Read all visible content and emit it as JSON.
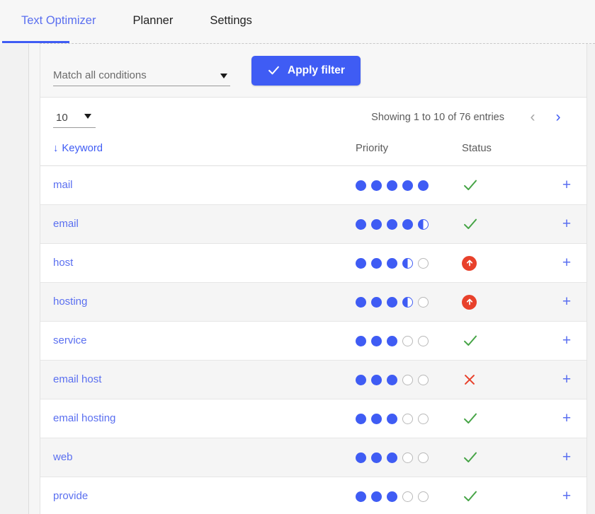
{
  "tabs": [
    {
      "label": "Text Optimizer",
      "active": true
    },
    {
      "label": "Planner",
      "active": false
    },
    {
      "label": "Settings",
      "active": false
    }
  ],
  "filter": {
    "condition_value": "Match all conditions",
    "condition_placeholder": "Match all conditions",
    "apply_label": "Apply filter",
    "check_icon": "check-icon",
    "caret_icon": "chevron-down-icon"
  },
  "pagination": {
    "page_length": "10",
    "entries_text": "Showing 1 to 10 of 76 entries",
    "prev_icon": "‹",
    "next_icon": "›",
    "prev_enabled": false,
    "next_enabled": true
  },
  "table": {
    "columns": {
      "keyword": "Keyword",
      "priority": "Priority",
      "status": "Status",
      "action": ""
    },
    "sort_arrow": "↓",
    "add_label": "+",
    "rows": [
      {
        "keyword": "mail",
        "priority": [
          "full",
          "full",
          "full",
          "full",
          "full"
        ],
        "status": "check"
      },
      {
        "keyword": "email",
        "priority": [
          "full",
          "full",
          "full",
          "full",
          "half"
        ],
        "status": "check"
      },
      {
        "keyword": "host",
        "priority": [
          "full",
          "full",
          "full",
          "half",
          "empty"
        ],
        "status": "up"
      },
      {
        "keyword": "hosting",
        "priority": [
          "full",
          "full",
          "full",
          "half",
          "empty"
        ],
        "status": "up"
      },
      {
        "keyword": "service",
        "priority": [
          "full",
          "full",
          "full",
          "empty",
          "empty"
        ],
        "status": "check"
      },
      {
        "keyword": "email host",
        "priority": [
          "full",
          "full",
          "full",
          "empty",
          "empty"
        ],
        "status": "cross"
      },
      {
        "keyword": "email hosting",
        "priority": [
          "full",
          "full",
          "full",
          "empty",
          "empty"
        ],
        "status": "check"
      },
      {
        "keyword": "web",
        "priority": [
          "full",
          "full",
          "full",
          "empty",
          "empty"
        ],
        "status": "check"
      },
      {
        "keyword": "provide",
        "priority": [
          "full",
          "full",
          "full",
          "empty",
          "empty"
        ],
        "status": "check"
      }
    ]
  },
  "colors": {
    "accent_blue": "#3f5cf4",
    "link_blue": "#5a6ff0",
    "status_green": "#46a446",
    "status_red": "#e8412b",
    "dot_empty": "#b9b9b9"
  }
}
